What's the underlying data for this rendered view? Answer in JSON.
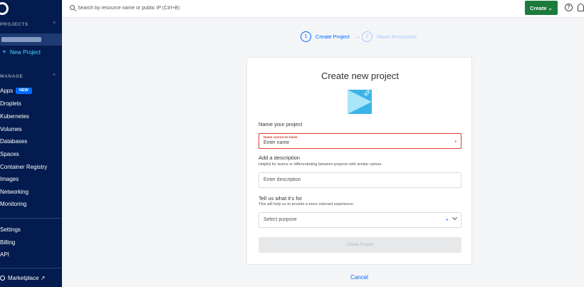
{
  "sidebar": {
    "projects_title": "PROJECTS",
    "new_project": "New Project",
    "manage_title": "MANAGE",
    "nav": [
      "Apps",
      "Droplets",
      "Kubernetes",
      "Volumes",
      "Databases",
      "Spaces",
      "Container Registry",
      "Images",
      "Networking",
      "Monitoring"
    ],
    "new_badge": "NEW",
    "bottom": [
      "Settings",
      "Billing",
      "API"
    ],
    "marketplace": "Marketplace ↗"
  },
  "topbar": {
    "search_placeholder": "Search by resource name or public IP (Ctrl+B)",
    "create_label": "Create"
  },
  "stepper": [
    {
      "num": "1",
      "label": "Create Project"
    },
    {
      "num": "2",
      "label": "Move Resources"
    }
  ],
  "form": {
    "title": "Create new project",
    "name_label": "Name your project",
    "name_error": "Name cannot be blank",
    "name_placeholder": "Enter name",
    "desc_label": "Add a description",
    "desc_help": "Helpful for teams or differentiating between projects with similar names.",
    "desc_placeholder": "Enter description",
    "purpose_label": "Tell us what it's for",
    "purpose_help": "This will help us to provide a more relevant experience.",
    "purpose_select": "Select purpose",
    "submit_label": "Create Project",
    "cancel_label": "Cancel"
  },
  "colors": {
    "sidebar_bg": "#031b4e",
    "accent": "#0069ff",
    "create_green": "#1b7b3b",
    "error": "#e03e2d"
  }
}
